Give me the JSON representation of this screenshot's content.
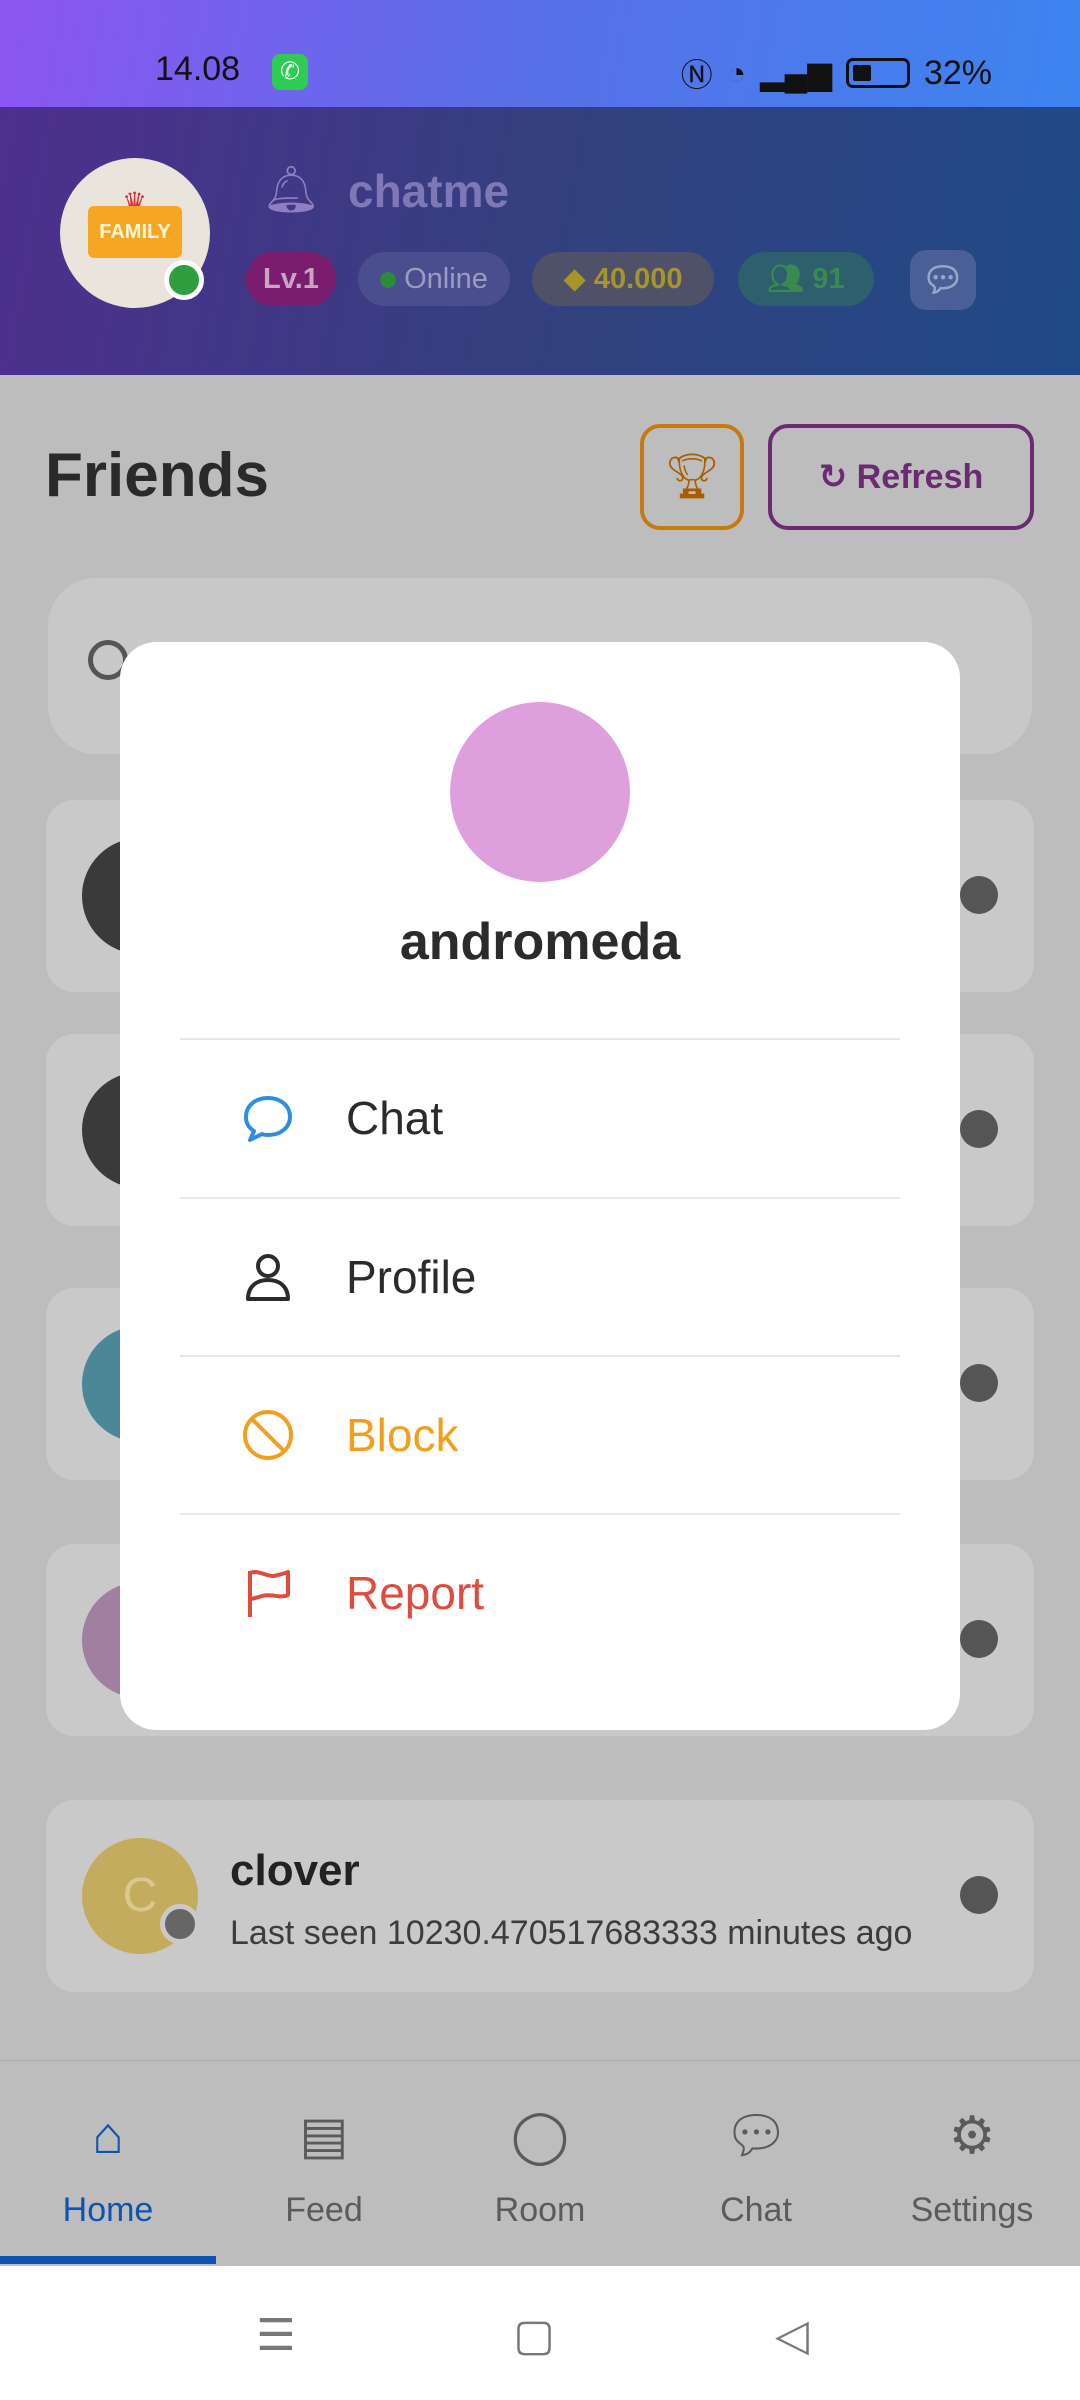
{
  "status_bar": {
    "time": "14.08",
    "battery": "32%"
  },
  "header": {
    "app_name": "chatme",
    "badge_text": "FAMILY",
    "level": "Lv.1",
    "presence": "Online",
    "gems": "40.000",
    "friends_count": "91"
  },
  "page": {
    "title": "Friends",
    "refresh_label": "Refresh"
  },
  "friends": [
    {
      "name": "clover",
      "initial": "C",
      "last_seen": "Last seen 10230.470517683333 minutes ago"
    }
  ],
  "modal": {
    "name": "andromeda",
    "avatar_color": "#dda0dd",
    "actions": [
      {
        "label": "Chat",
        "icon": "chat-bubble-icon",
        "color": "#2b2b2b"
      },
      {
        "label": "Profile",
        "icon": "person-icon",
        "color": "#2b2b2b"
      },
      {
        "label": "Block",
        "icon": "block-icon",
        "color": "#f0a020"
      },
      {
        "label": "Report",
        "icon": "flag-icon",
        "color": "#e04b40"
      }
    ]
  },
  "bottom_nav": [
    {
      "label": "Home",
      "icon": "home-icon",
      "active": true
    },
    {
      "label": "Feed",
      "icon": "feed-icon",
      "active": false
    },
    {
      "label": "Room",
      "icon": "room-icon",
      "active": false
    },
    {
      "label": "Chat",
      "icon": "chat-icon",
      "active": false
    },
    {
      "label": "Settings",
      "icon": "gear-icon",
      "active": false
    }
  ]
}
